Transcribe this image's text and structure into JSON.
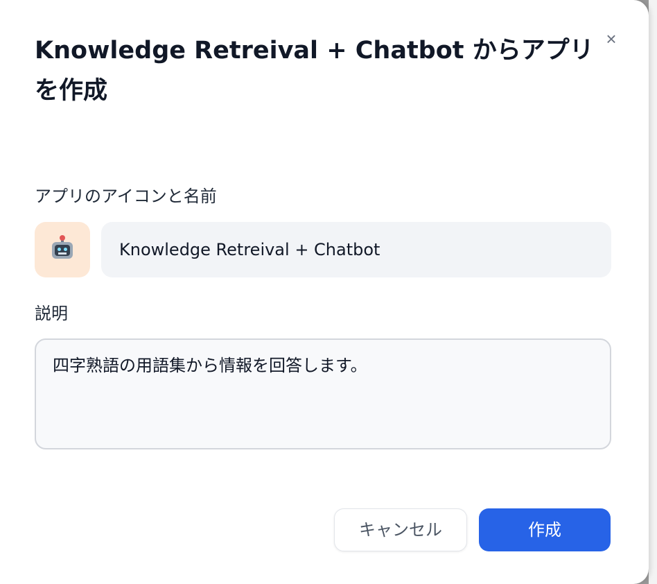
{
  "dialog": {
    "title": "Knowledge Retreival + Chatbot からアプリを作成",
    "close_icon": "close-icon"
  },
  "app_icon": {
    "label": "アプリのアイコンと名前",
    "emoji_name": "robot-icon",
    "background": "#fde8d6"
  },
  "name_field": {
    "value": "Knowledge Retreival + Chatbot"
  },
  "description": {
    "label": "説明",
    "value": "四字熟語の用語集から情報を回答します。"
  },
  "footer": {
    "cancel_label": "キャンセル",
    "create_label": "作成"
  },
  "colors": {
    "primary": "#2763e7",
    "text": "#111827"
  }
}
